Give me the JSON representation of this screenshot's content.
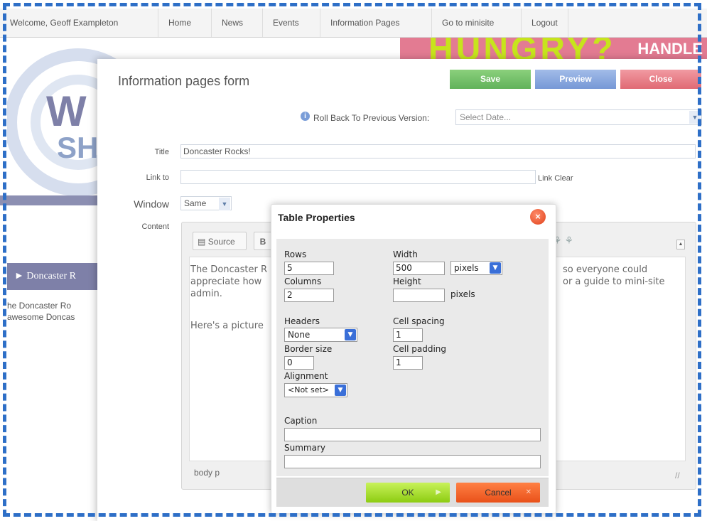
{
  "nav": {
    "welcome": "Welcome, Geoff Exampleton",
    "items": [
      "Home",
      "News",
      "Events",
      "Information Pages",
      "Go to minisite",
      "Logout"
    ]
  },
  "background": {
    "banner_text": "HUNGRY?",
    "banner_right": "HANDLE",
    "swirl_letters": "W",
    "swirl_letters2": "SH",
    "side_item": "Doncaster R",
    "side_text_1": "he Doncaster Ro",
    "side_text_2": "awesome Doncas"
  },
  "form": {
    "title": "Information pages form",
    "save": "Save",
    "preview": "Preview",
    "close": "Close",
    "rollback_label": "Roll Back To Previous Version:",
    "rollback_value": "Select Date...",
    "title_label": "Title",
    "title_value": "Doncaster Rocks!",
    "link_label": "Link to",
    "link_value": "",
    "link_clear": "Link Clear",
    "window_label": "Window",
    "window_value": "Same",
    "content_label": "Content"
  },
  "editor": {
    "source": "Source",
    "bold": "B",
    "text_left_1": "The Doncaster R",
    "text_left_2": "appreciate how",
    "text_left_3": "admin.",
    "text_right_1": "so everyone could",
    "text_right_2": "or a guide to mini-site",
    "text_para2": "Here's a picture",
    "path": "body  p",
    "icons": "⚘ ⚘"
  },
  "dialog": {
    "title": "Table Properties",
    "rows_label": "Rows",
    "rows_value": "5",
    "columns_label": "Columns",
    "columns_value": "2",
    "width_label": "Width",
    "width_value": "500",
    "width_unit": "pixels",
    "height_label": "Height",
    "height_value": "",
    "height_unit": "pixels",
    "headers_label": "Headers",
    "headers_value": "None",
    "border_label": "Border size",
    "border_value": "0",
    "alignment_label": "Alignment",
    "alignment_value": "<Not set>",
    "cell_spacing_label": "Cell spacing",
    "cell_spacing_value": "1",
    "cell_padding_label": "Cell padding",
    "cell_padding_value": "1",
    "caption_label": "Caption",
    "caption_value": "",
    "summary_label": "Summary",
    "summary_value": "",
    "ok": "OK",
    "cancel": "Cancel"
  },
  "colors": {
    "frame": "#2e6fc7",
    "save": "#61b25b",
    "preview": "#7698d6",
    "close": "#e06a74",
    "ok": "#8dcc12",
    "cancel": "#e9511a"
  }
}
